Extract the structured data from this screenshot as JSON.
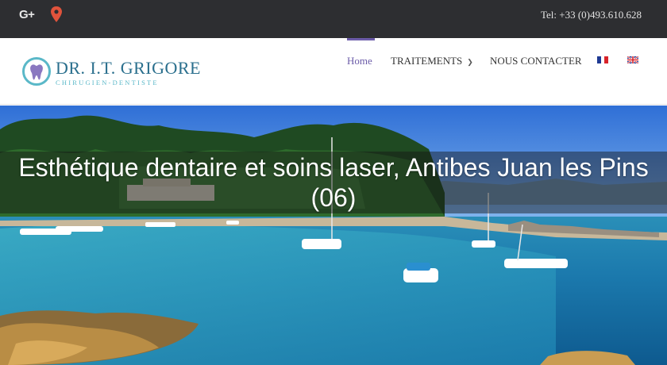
{
  "topbar": {
    "social": [
      {
        "icon": "google-plus-icon",
        "label": "G+"
      },
      {
        "icon": "map-pin-icon"
      }
    ],
    "phone": "Tel: +33 (0)493.610.628"
  },
  "logo": {
    "name": "DR. I.T. GRIGORE",
    "subtitle": "CHIRUGIEN-DENTISTE",
    "icon": "tooth-icon"
  },
  "nav": {
    "items": [
      {
        "label": "Home",
        "active": true
      },
      {
        "label": "TRAITEMENTS",
        "dropdown": true
      },
      {
        "label": "NOUS CONTACTER"
      }
    ],
    "flags": [
      {
        "icon": "flag-fr-icon"
      },
      {
        "icon": "flag-uk-icon"
      }
    ]
  },
  "hero": {
    "title": "Esthétique dentaire et soins laser, Antibes Juan les Pins (06)"
  },
  "colors": {
    "topbar_bg": "#2d2e31",
    "accent": "#6b5ba8",
    "logo_primary": "#2a6f8d",
    "logo_secondary": "#5ab8c8"
  }
}
